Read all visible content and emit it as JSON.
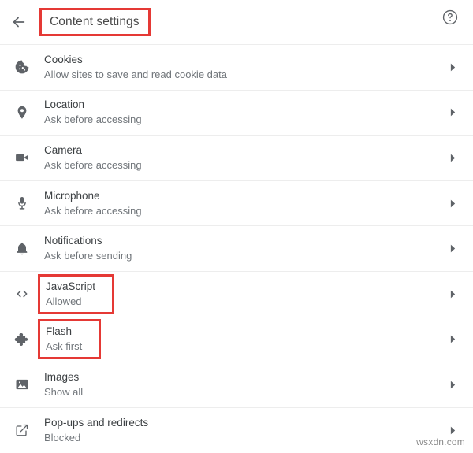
{
  "header": {
    "back_icon": "back-arrow-icon",
    "title": "Content settings",
    "help_icon": "help-circle-icon",
    "title_highlighted": true
  },
  "settings_list": [
    {
      "icon": "cookie-icon",
      "title": "Cookies",
      "subtitle": "Allow sites to save and read cookie data",
      "chevron": "chevron-right-icon",
      "highlighted": false
    },
    {
      "icon": "location-pin-icon",
      "title": "Location",
      "subtitle": "Ask before accessing",
      "chevron": "chevron-right-icon",
      "highlighted": false
    },
    {
      "icon": "camera-icon",
      "title": "Camera",
      "subtitle": "Ask before accessing",
      "chevron": "chevron-right-icon",
      "highlighted": false
    },
    {
      "icon": "microphone-icon",
      "title": "Microphone",
      "subtitle": "Ask before accessing",
      "chevron": "chevron-right-icon",
      "highlighted": false
    },
    {
      "icon": "bell-icon",
      "title": "Notifications",
      "subtitle": "Ask before sending",
      "chevron": "chevron-right-icon",
      "highlighted": false
    },
    {
      "icon": "code-brackets-icon",
      "title": "JavaScript",
      "subtitle": "Allowed",
      "chevron": "chevron-right-icon",
      "highlighted": true
    },
    {
      "icon": "puzzle-piece-icon",
      "title": "Flash",
      "subtitle": "Ask first",
      "chevron": "chevron-right-icon",
      "highlighted": true
    },
    {
      "icon": "image-icon",
      "title": "Images",
      "subtitle": "Show all",
      "chevron": "chevron-right-icon",
      "highlighted": false
    },
    {
      "icon": "external-link-icon",
      "title": "Pop-ups and redirects",
      "subtitle": "Blocked",
      "chevron": "chevron-right-icon",
      "highlighted": false
    }
  ],
  "watermark": "wsxdn.com",
  "colors": {
    "highlight": "#e53935",
    "title_text": "#3c4043",
    "subtitle_text": "#70757a",
    "icon": "#5f6368",
    "divider": "#ededed",
    "background": "#ffffff"
  }
}
